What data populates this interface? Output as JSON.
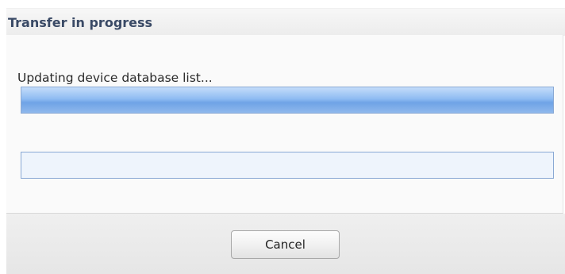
{
  "dialog": {
    "title": "Transfer in progress",
    "status_text": "Updating device database list...",
    "progress_bars": [
      {
        "fraction": 1.0
      },
      {
        "fraction": 0.0
      }
    ],
    "cancel_label": "Cancel"
  },
  "colors": {
    "title_text": "#3a4a66",
    "progress_border": "#8aa9d4",
    "progress_fill": "#6fa3e6",
    "progress_track": "#eef4fc"
  }
}
